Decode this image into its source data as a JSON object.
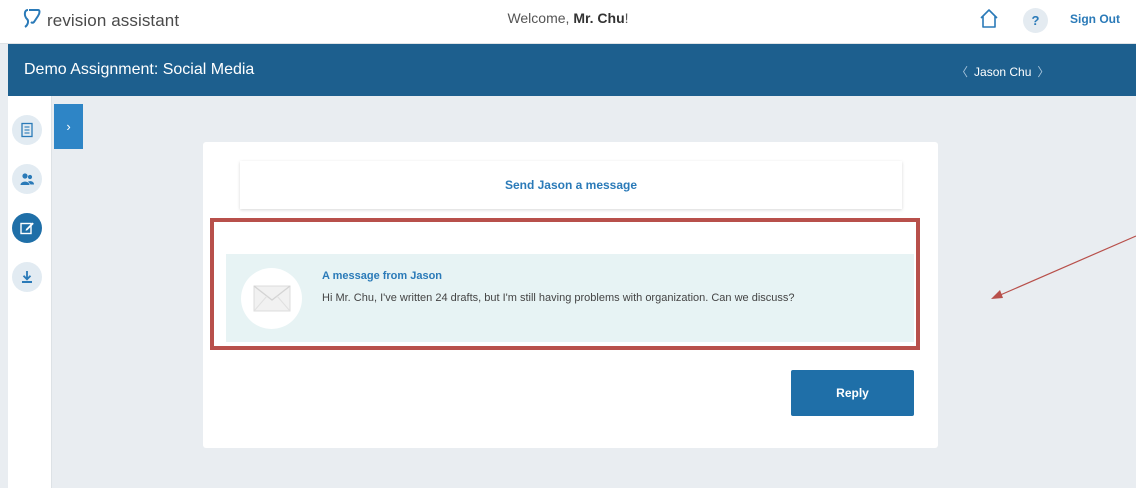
{
  "app": {
    "name": "revision assistant",
    "welcome_prefix": "Welcome,",
    "welcome_name": "Mr. Chu",
    "welcome_suffix": "!",
    "help_label": "?",
    "signout_label": "Sign Out"
  },
  "assignment": {
    "title": "Demo Assignment: Social Media",
    "student_name": "Jason Chu",
    "prev_glyph": "〈",
    "next_glyph": "〉"
  },
  "sidebar": {
    "expand_glyph": "›",
    "icons": [
      "document-icon",
      "students-icon",
      "edit-icon",
      "download-icon"
    ],
    "active": "edit-icon"
  },
  "main": {
    "send_message_label": "Send Jason a message",
    "message": {
      "title": "A message from Jason",
      "body": "Hi Mr. Chu, I've written 24 drafts, but I'm still having problems with organization. Can we discuss?"
    },
    "reply_label": "Reply"
  },
  "colors": {
    "brand": "#1d5f8e",
    "accent": "#2a7ab8",
    "highlight": "#b8504b",
    "message_bg": "#e7f3f4"
  }
}
